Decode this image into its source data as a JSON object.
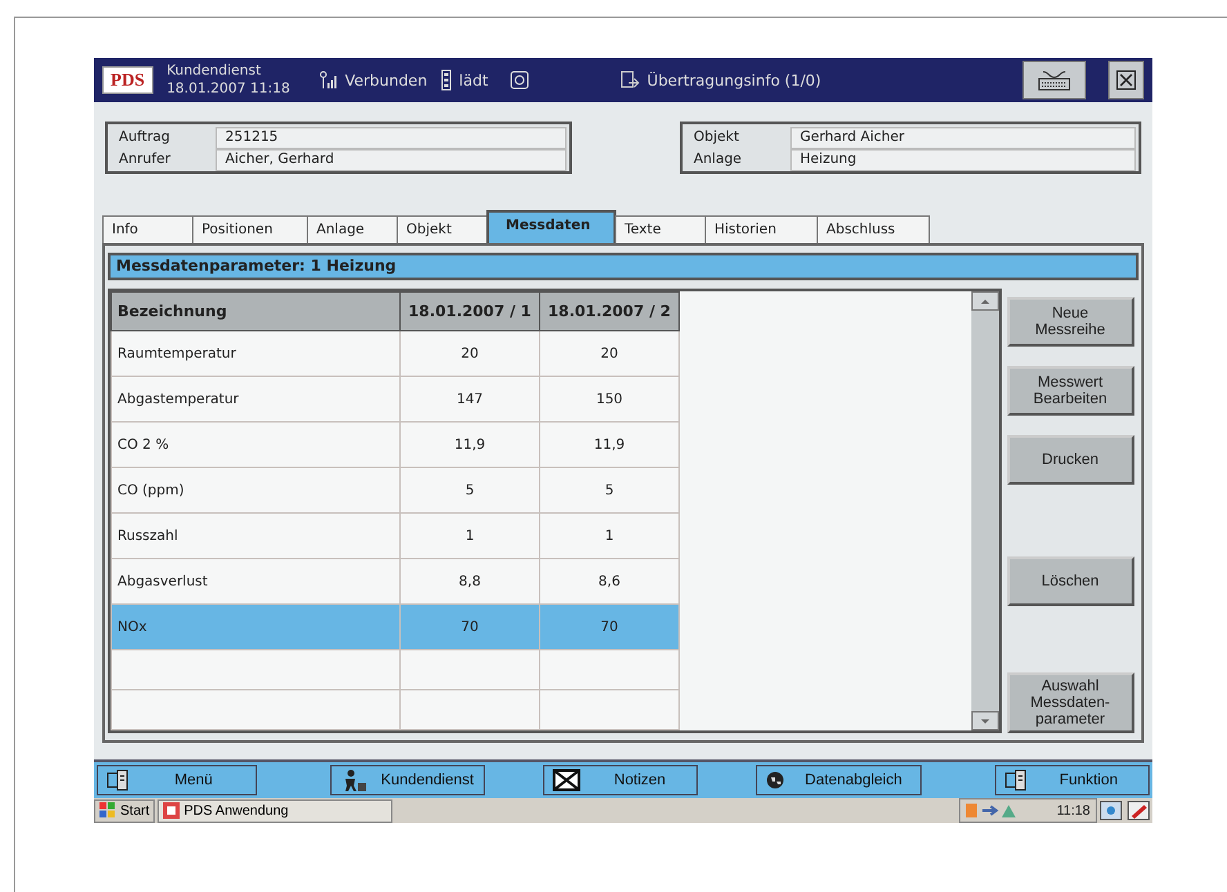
{
  "title_bar": {
    "app": "PDS",
    "title": "Kundendienst",
    "datetime": "18.01.2007 11:18",
    "connection": "Verbunden",
    "battery": "lädt",
    "transfer": "Übertragungsinfo (1/0)"
  },
  "order": [
    {
      "label": "Auftrag",
      "value": "251215"
    },
    {
      "label": "Anrufer",
      "value": "Aicher, Gerhard"
    }
  ],
  "object": [
    {
      "label": "Objekt",
      "value": "Gerhard Aicher"
    },
    {
      "label": "Anlage",
      "value": "Heizung"
    }
  ],
  "tabs": [
    {
      "label": "Info",
      "selected": false
    },
    {
      "label": "Positionen",
      "selected": false
    },
    {
      "label": "Anlage",
      "selected": false
    },
    {
      "label": "Objekt",
      "selected": false
    },
    {
      "label": "Messdaten",
      "selected": true
    },
    {
      "label": "Texte",
      "selected": false
    },
    {
      "label": "Historien",
      "selected": false
    },
    {
      "label": "Abschluss",
      "selected": false
    }
  ],
  "panel_title": "Messdatenparameter: 1 Heizung",
  "table": {
    "columns": [
      "Bezeichnung",
      "18.01.2007 / 1",
      "18.01.2007 / 2"
    ],
    "rows": [
      {
        "cells": [
          "Raumtemperatur",
          "20",
          "20"
        ],
        "selected": false
      },
      {
        "cells": [
          "Abgastemperatur",
          "147",
          "150"
        ],
        "selected": false
      },
      {
        "cells": [
          "CO 2 %",
          "11,9",
          "11,9"
        ],
        "selected": false
      },
      {
        "cells": [
          "CO (ppm)",
          "5",
          "5"
        ],
        "selected": false
      },
      {
        "cells": [
          "Russzahl",
          "1",
          "1"
        ],
        "selected": false
      },
      {
        "cells": [
          "Abgasverlust",
          "8,8",
          "8,6"
        ],
        "selected": false
      },
      {
        "cells": [
          "NOx",
          "70",
          "70"
        ],
        "selected": true
      }
    ]
  },
  "side_buttons": [
    "Neue Messreihe",
    "Messwert Bearbeiten",
    "Drucken",
    "Löschen",
    "Auswahl Messdaten-parameter"
  ],
  "bottom_buttons": [
    "Menü",
    "Kundendienst",
    "Notizen",
    "Datenabgleich",
    "Funktion"
  ],
  "taskbar": {
    "start": "Start",
    "task": "PDS Anwendung",
    "time": "11:18"
  }
}
